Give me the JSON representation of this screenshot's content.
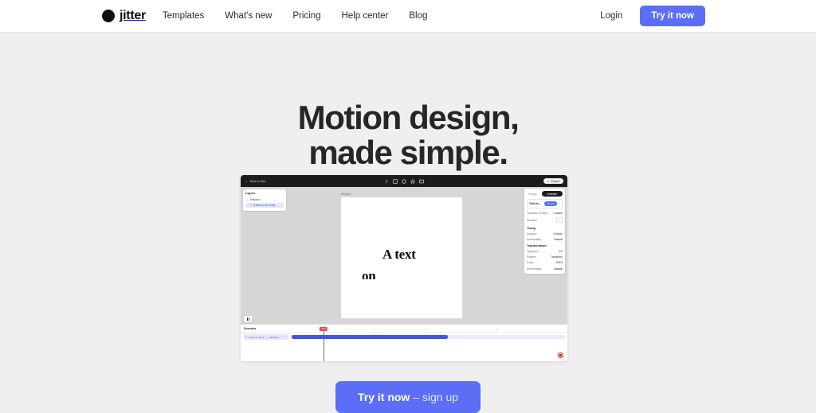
{
  "navbar": {
    "logo": {
      "text": "jitter",
      "icon": "circle-logo-icon"
    },
    "links": [
      {
        "label": "Templates"
      },
      {
        "label": "What's new"
      },
      {
        "label": "Pricing"
      },
      {
        "label": "Help center"
      },
      {
        "label": "Blog"
      }
    ],
    "login_label": "Login",
    "cta_label": "Try it now",
    "accent_color": "#5b6ef5"
  },
  "hero": {
    "headline_line1": "Motion design,",
    "headline_line2": "made simple.",
    "cta_strong": "Try it now",
    "cta_light": "– sign up"
  },
  "app": {
    "topbar": {
      "back_label": "Back to files",
      "export_label": "Export",
      "tools": [
        {
          "name": "text-tool-icon",
          "glyph": "T"
        },
        {
          "name": "rectangle-tool-icon",
          "glyph": "square"
        },
        {
          "name": "ellipse-tool-icon",
          "glyph": "circle"
        },
        {
          "name": "star-tool-icon",
          "glyph": "star"
        },
        {
          "name": "image-tool-icon",
          "glyph": "image"
        }
      ]
    },
    "layers": {
      "title": "Layers",
      "items": [
        {
          "label": "Artboard",
          "selected": false
        },
        {
          "label": "A text on two lines",
          "selected": true
        }
      ]
    },
    "canvas": {
      "artboard_label": "Artboard",
      "text_line1": "A text",
      "text_line2": "on"
    },
    "properties": {
      "tabs": [
        {
          "label": "Design",
          "active": false
        },
        {
          "label": "Animate",
          "active": true
        }
      ],
      "layer_name": "Text on...",
      "layer_badge": "Preset",
      "rows": [
        {
          "label": "Transition Presets",
          "value": "Custom"
        },
        {
          "label": "Direction",
          "value": "↕"
        }
      ],
      "sections": [
        {
          "title": "Timing",
          "rows": [
            {
              "label": "Duration",
              "value": "0,60sec"
            },
            {
              "label": "Acceleration",
              "value": "Natural"
            }
          ]
        },
        {
          "title": "Transformation",
          "rows": [
            {
              "label": "Opacity In",
              "value": "0%"
            },
            {
              "label": "Position",
              "value": "Transform"
            },
            {
              "label": "Scale",
              "value": "100%"
            },
            {
              "label": "Accelerating",
              "value": "Natural"
            }
          ]
        }
      ]
    },
    "timeline": {
      "scene_label": "Scenario",
      "time_badge": "0:06",
      "ticks": [
        "1s",
        "2s",
        "3s",
        "4s"
      ],
      "row_label": "A text on two li...",
      "row_sublabel": "Word up",
      "play_icon": "pause-icon",
      "record_icon": "record-stop-icon"
    }
  }
}
